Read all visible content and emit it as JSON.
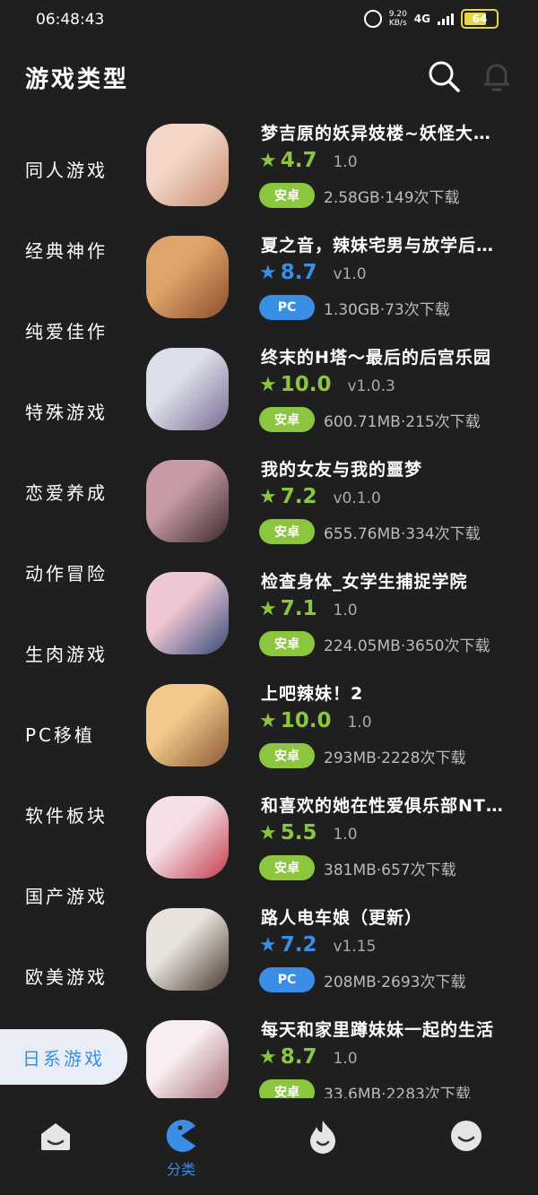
{
  "status_bar": {
    "time": "06:48:43",
    "speed_top": "9.20",
    "speed_bottom": "KB/s",
    "network": "4G",
    "battery": "64"
  },
  "header": {
    "title": "游戏类型",
    "search_icon": "search-icon",
    "bell_icon": "bell-icon"
  },
  "sidebar": {
    "items": [
      {
        "label": "同人游戏"
      },
      {
        "label": "经典神作"
      },
      {
        "label": "纯爱佳作"
      },
      {
        "label": "特殊游戏"
      },
      {
        "label": "恋爱养成"
      },
      {
        "label": "动作冒险"
      },
      {
        "label": "生肉游戏"
      },
      {
        "label": "PC移植"
      },
      {
        "label": "软件板块"
      },
      {
        "label": "国产游戏"
      },
      {
        "label": "欧美游戏"
      },
      {
        "label": "日系游戏"
      }
    ],
    "active_index": 11
  },
  "colors": {
    "green": "#8cc63f",
    "blue": "#3a8ee6",
    "background": "#1f1f1f"
  },
  "games": [
    {
      "name": "梦吉原的妖异妓楼~妖怪大…",
      "score": "4.7",
      "version": "1.0",
      "platform": "安卓",
      "platform_type": "android",
      "stats": "2.58GB·149次下载",
      "thumb_colors": [
        "#f3d6c7",
        "#c78a6a"
      ]
    },
    {
      "name": "夏之音，辣妹宅男与放学后…",
      "score": "8.7",
      "version": "v1.0",
      "platform": "PC",
      "platform_type": "pc",
      "stats": "1.30GB·73次下载",
      "thumb_colors": [
        "#e0a36a",
        "#8a4f2e"
      ]
    },
    {
      "name": "终末的H塔～最后的后宫乐园",
      "score": "10.0",
      "version": "v1.0.3",
      "platform": "安卓",
      "platform_type": "android",
      "stats": "600.71MB·215次下载",
      "thumb_colors": [
        "#dcdfea",
        "#7a6a92"
      ]
    },
    {
      "name": "我的女友与我的噩梦",
      "score": "7.2",
      "version": "v0.1.0",
      "platform": "安卓",
      "platform_type": "android",
      "stats": "655.76MB·334次下载",
      "thumb_colors": [
        "#c79aa6",
        "#3b2b2b"
      ]
    },
    {
      "name": "检查身体_女学生捕捉学院",
      "score": "7.1",
      "version": "1.0",
      "platform": "安卓",
      "platform_type": "android",
      "stats": "224.05MB·3650次下载",
      "thumb_colors": [
        "#eec7d3",
        "#354a78"
      ]
    },
    {
      "name": "上吧辣妹！2",
      "score": "10.0",
      "version": "1.0",
      "platform": "安卓",
      "platform_type": "android",
      "stats": "293MB·2228次下载",
      "thumb_colors": [
        "#f2c98a",
        "#8a5a36"
      ]
    },
    {
      "name": "和喜欢的她在性爱俱乐部NT…",
      "score": "5.5",
      "version": "1.0",
      "platform": "安卓",
      "platform_type": "android",
      "stats": "381MB·657次下载",
      "thumb_colors": [
        "#f4e0e6",
        "#c73b4a"
      ]
    },
    {
      "name": "路人电车娘（更新）",
      "score": "7.2",
      "version": "v1.15",
      "platform": "PC",
      "platform_type": "pc",
      "stats": "208MB·2693次下载",
      "thumb_colors": [
        "#e7e2dc",
        "#4a3a2f"
      ]
    },
    {
      "name": "每天和家里蹲妹妹一起的生活",
      "score": "8.7",
      "version": "1.0",
      "platform": "安卓",
      "platform_type": "android",
      "stats": "33.6MB·2283次下载",
      "thumb_colors": [
        "#f8eef0",
        "#a36a73"
      ]
    }
  ],
  "tabbar": {
    "active_label": "分类",
    "tabs": [
      "home-icon",
      "category-icon",
      "fire-icon",
      "profile-icon"
    ]
  }
}
